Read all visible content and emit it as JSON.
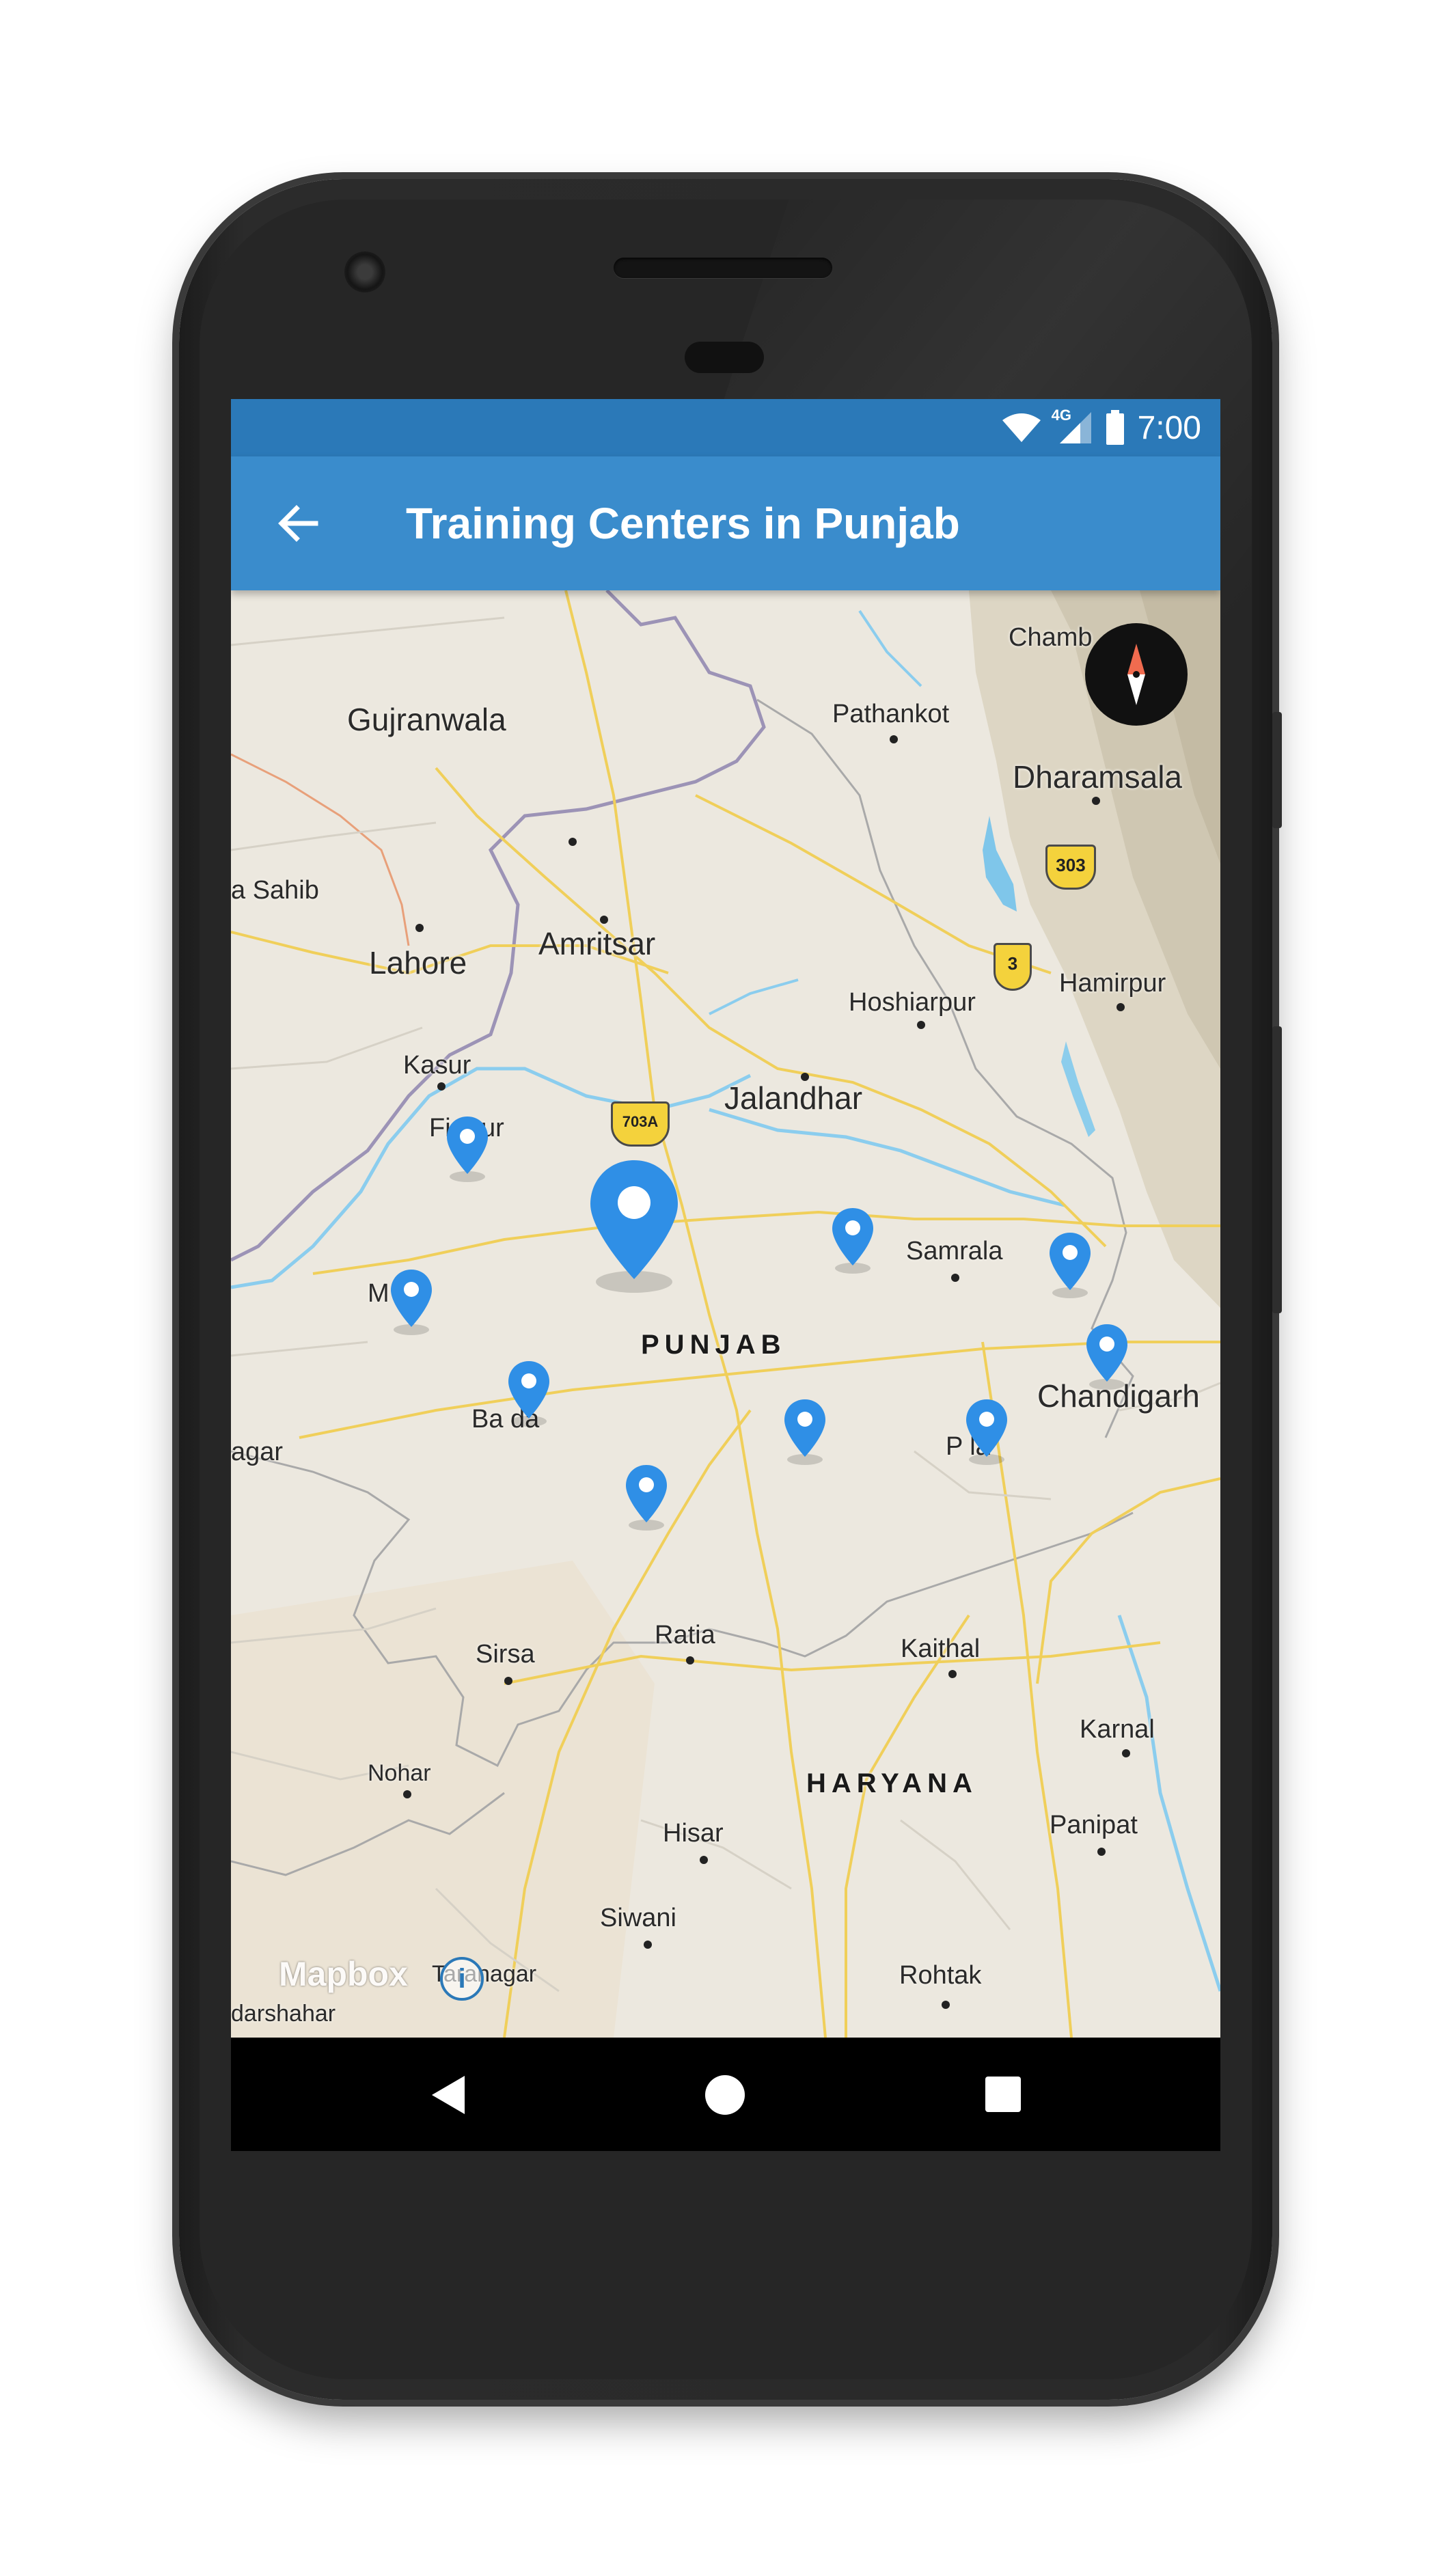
{
  "status_bar": {
    "time": "7:00",
    "network": "4G",
    "icons": [
      "wifi-icon",
      "cell-signal-icon",
      "battery-icon"
    ],
    "background": "#2b79b8"
  },
  "toolbar": {
    "back_icon": "arrow-back-icon",
    "title": "Training Centers in Punjab",
    "background": "#3a8ccc"
  },
  "map": {
    "provider_logo": "Mapbox",
    "info_icon": "i",
    "compass_icon": "compass-icon",
    "pin_color": "#2f8fe6",
    "cities": {
      "gujranwala": "Gujranwala",
      "sahib": "a Sahib",
      "lahore": "Lahore",
      "amritsar": "Amritsar",
      "pathankot": "Pathankot",
      "chamba": "Chamb",
      "dharamsala": "Dharamsala",
      "hoshiarpur": "Hoshiarpur",
      "hamirpur": "Hamirpur",
      "kasur": "Kasur",
      "firozpur": "Fir   pur",
      "jalandhar": "Jalandhar",
      "samrala": "Samrala",
      "muktsar": "M     ar",
      "chandigarh": "Chandigarh",
      "bathinda": "Ba       da",
      "agar": "agar",
      "patiala": "P     la",
      "sirsa": "Sirsa",
      "ratia": "Ratia",
      "kaithal": "Kaithal",
      "karnal": "Karnal",
      "nohar": "Nohar",
      "hisar": "Hisar",
      "panipat": "Panipat",
      "siwani": "Siwani",
      "taranagar": "Taranagar",
      "darshahar": "darshahar",
      "rohtak": "Rohtak"
    },
    "states": {
      "punjab": "PUNJAB",
      "haryana": "HARYANA"
    },
    "highways": [
      "303",
      "3",
      "703A"
    ]
  }
}
